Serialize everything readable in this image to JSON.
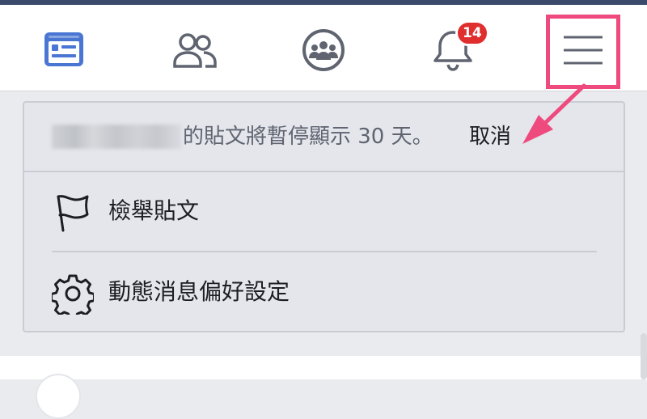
{
  "nav": {
    "icons": [
      "news-feed-icon",
      "friends-icon",
      "groups-icon",
      "notifications-icon",
      "menu-icon"
    ],
    "notification_count": "14",
    "active_color": "#4a76d3",
    "icon_color": "#5f6470"
  },
  "annotation": {
    "highlight_color": "#ef4a7e"
  },
  "snooze": {
    "message": "的貼文將暫停顯示 30 天。",
    "undo_label": "取消"
  },
  "menu": {
    "items": [
      {
        "label": "檢舉貼文",
        "icon": "flag-icon"
      },
      {
        "label": "動態消息偏好設定",
        "icon": "gear-icon"
      }
    ]
  }
}
